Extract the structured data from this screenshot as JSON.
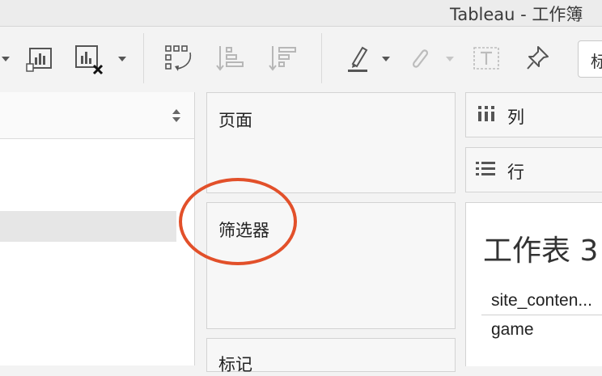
{
  "window": {
    "title": "Tableau - 工作簿"
  },
  "toolbar": {
    "mark_type_value": "标"
  },
  "left_pane": {},
  "cards": {
    "pages_label": "页面",
    "filters_label": "筛选器",
    "marks_label": "标记"
  },
  "shelves": {
    "columns_label": "列",
    "rows_label": "行"
  },
  "view": {
    "title": "工作表 3",
    "column_header": "site_conten...",
    "rows": [
      "game"
    ]
  },
  "annotation": {
    "color": "#e2502a"
  }
}
